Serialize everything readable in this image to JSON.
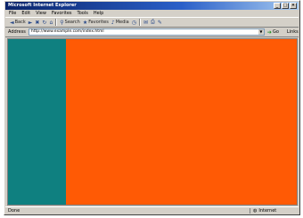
{
  "window": {
    "title": "Microsoft Internet Explorer"
  },
  "menu": [
    "File",
    "Edit",
    "View",
    "Favorites",
    "Tools",
    "Help"
  ],
  "toolbar": [
    {
      "icon": "back-icon",
      "glyph": "◄",
      "label": "Back"
    },
    {
      "icon": "forward-icon",
      "glyph": "►",
      "label": ""
    },
    {
      "icon": "stop-icon",
      "glyph": "✖",
      "label": ""
    },
    {
      "icon": "refresh-icon",
      "glyph": "↻",
      "label": ""
    },
    {
      "icon": "home-icon",
      "glyph": "⌂",
      "label": ""
    },
    {
      "icon": "search-icon",
      "glyph": "⚲",
      "label": "Search"
    },
    {
      "icon": "favorites-icon",
      "glyph": "★",
      "label": "Favorites"
    },
    {
      "icon": "media-icon",
      "glyph": "♪",
      "label": "Media"
    },
    {
      "icon": "history-icon",
      "glyph": "◷",
      "label": ""
    },
    {
      "icon": "mail-icon",
      "glyph": "✉",
      "label": ""
    },
    {
      "icon": "print-icon",
      "glyph": "⎙",
      "label": ""
    },
    {
      "icon": "edit-icon",
      "glyph": "✎",
      "label": ""
    }
  ],
  "address": {
    "label": "Address",
    "value": "http://www.example.com/index.html"
  },
  "go": {
    "label": "Go"
  },
  "links": {
    "label": "Links"
  },
  "frames": {
    "left_color": "#0f8080",
    "main_color": "#ff5a05"
  },
  "status": {
    "text": "Done",
    "zone": "Internet"
  }
}
